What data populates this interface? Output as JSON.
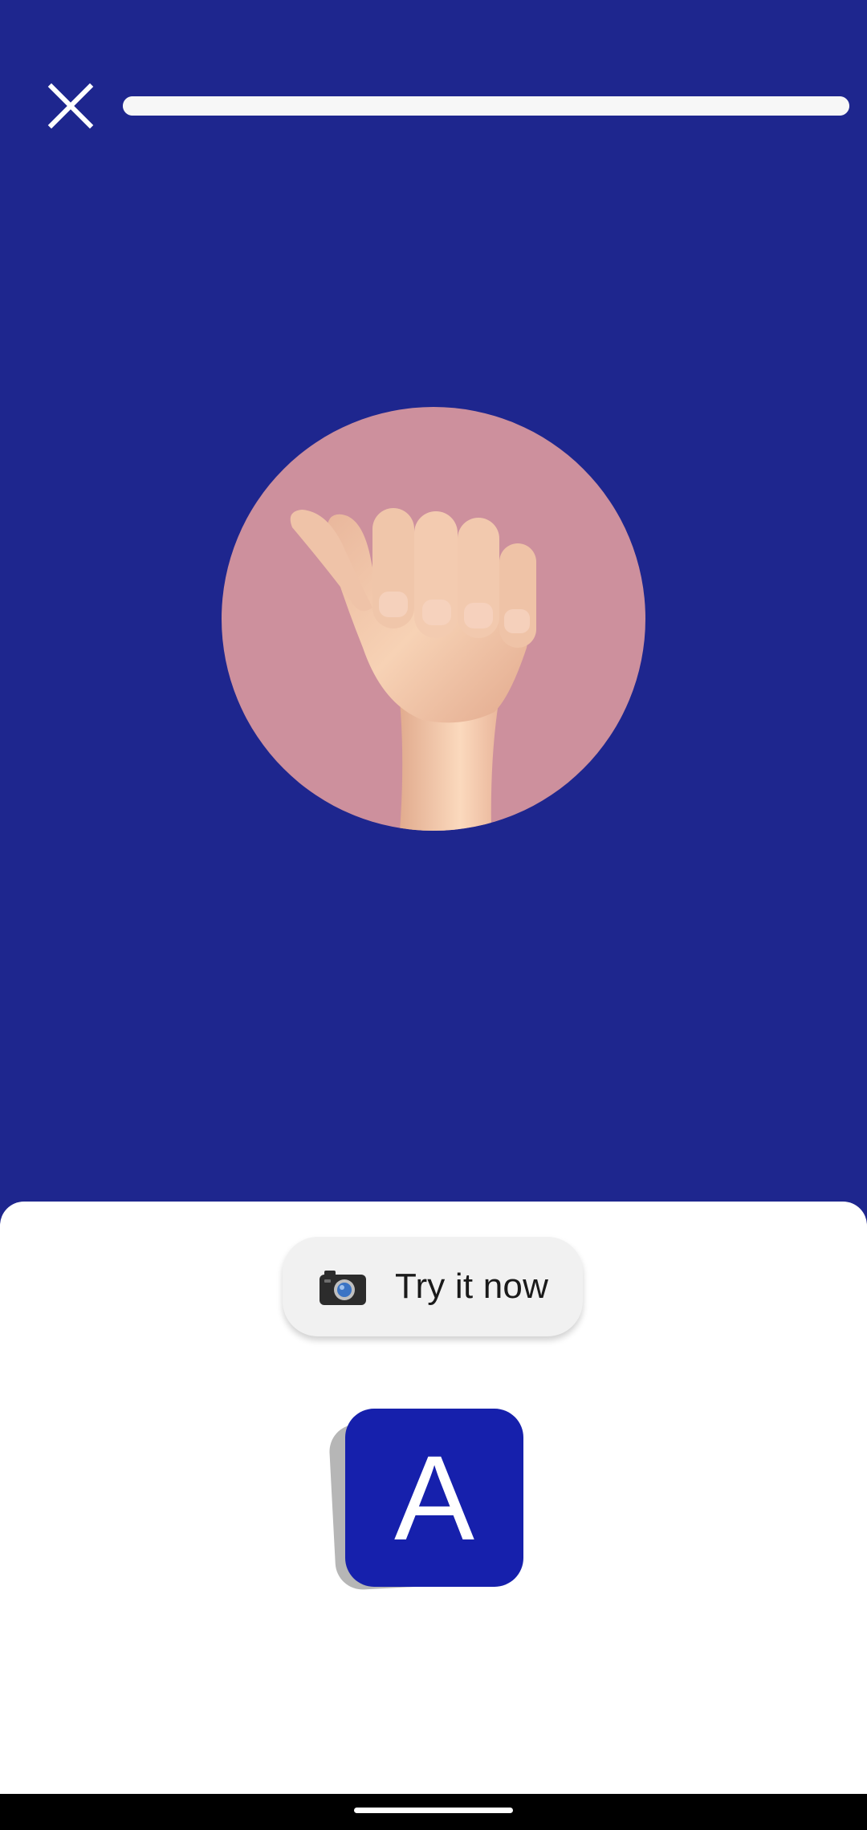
{
  "header": {
    "close_icon": "close-icon",
    "progress": 1.0,
    "progress_color": "#f7f7f7"
  },
  "hero": {
    "icon": "hand-sign-a-illustration",
    "background_color": "#cd909d"
  },
  "sheet": {
    "try_button": {
      "icon": "camera-icon",
      "label": "Try it now"
    },
    "letter_card": {
      "letter": "A",
      "color": "#1620ac"
    }
  },
  "colors": {
    "background": "#1e268e",
    "sheet": "#ffffff"
  }
}
